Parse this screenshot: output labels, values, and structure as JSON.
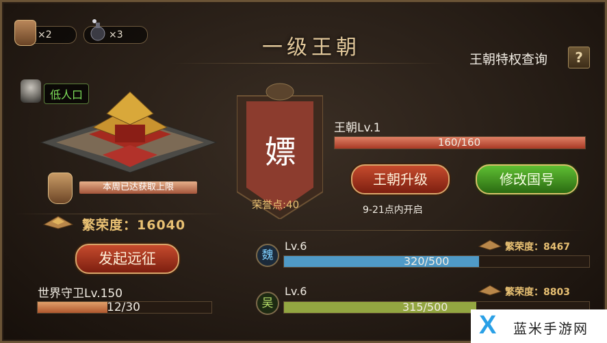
{
  "top_bar": {
    "item1_icon": "expedition-token-icon",
    "item1_count": "×2",
    "item2_icon": "bomb-icon",
    "item2_count": "×3"
  },
  "header": {
    "title": "一级王朝",
    "privilege_query": "王朝特权查询",
    "help_label": "?"
  },
  "left": {
    "population_tag": "低人口",
    "weekly_limit": "本周已达获取上限",
    "prosperity_label": "繁荣度：16040",
    "expedition_button": "发起远征",
    "world_guard": "世界守卫Lv.150",
    "world_guard_progress": "12/30",
    "world_guard_ratio": 0.4
  },
  "banner": {
    "name": "嫖",
    "honor": "荣誉点:40"
  },
  "dynasty": {
    "level": "王朝Lv.1",
    "progress": "160/160",
    "progress_ratio": 1.0,
    "upgrade_button": "王朝升级",
    "rename_button": "修改国号",
    "open_time": "9-21点内开启"
  },
  "kingdoms": [
    {
      "badge": "魏",
      "level": "Lv.6",
      "progress": "320/500",
      "ratio": 0.64,
      "prosperity": "繁荣度：8467",
      "bar_color": "#4f9ac7"
    },
    {
      "badge": "吴",
      "level": "Lv.6",
      "progress": "315/500",
      "ratio": 0.63,
      "prosperity": "繁荣度：8803",
      "bar_color": "#93a641"
    }
  ],
  "watermark": {
    "logo_letter": "X",
    "text": "蓝米手游网"
  }
}
